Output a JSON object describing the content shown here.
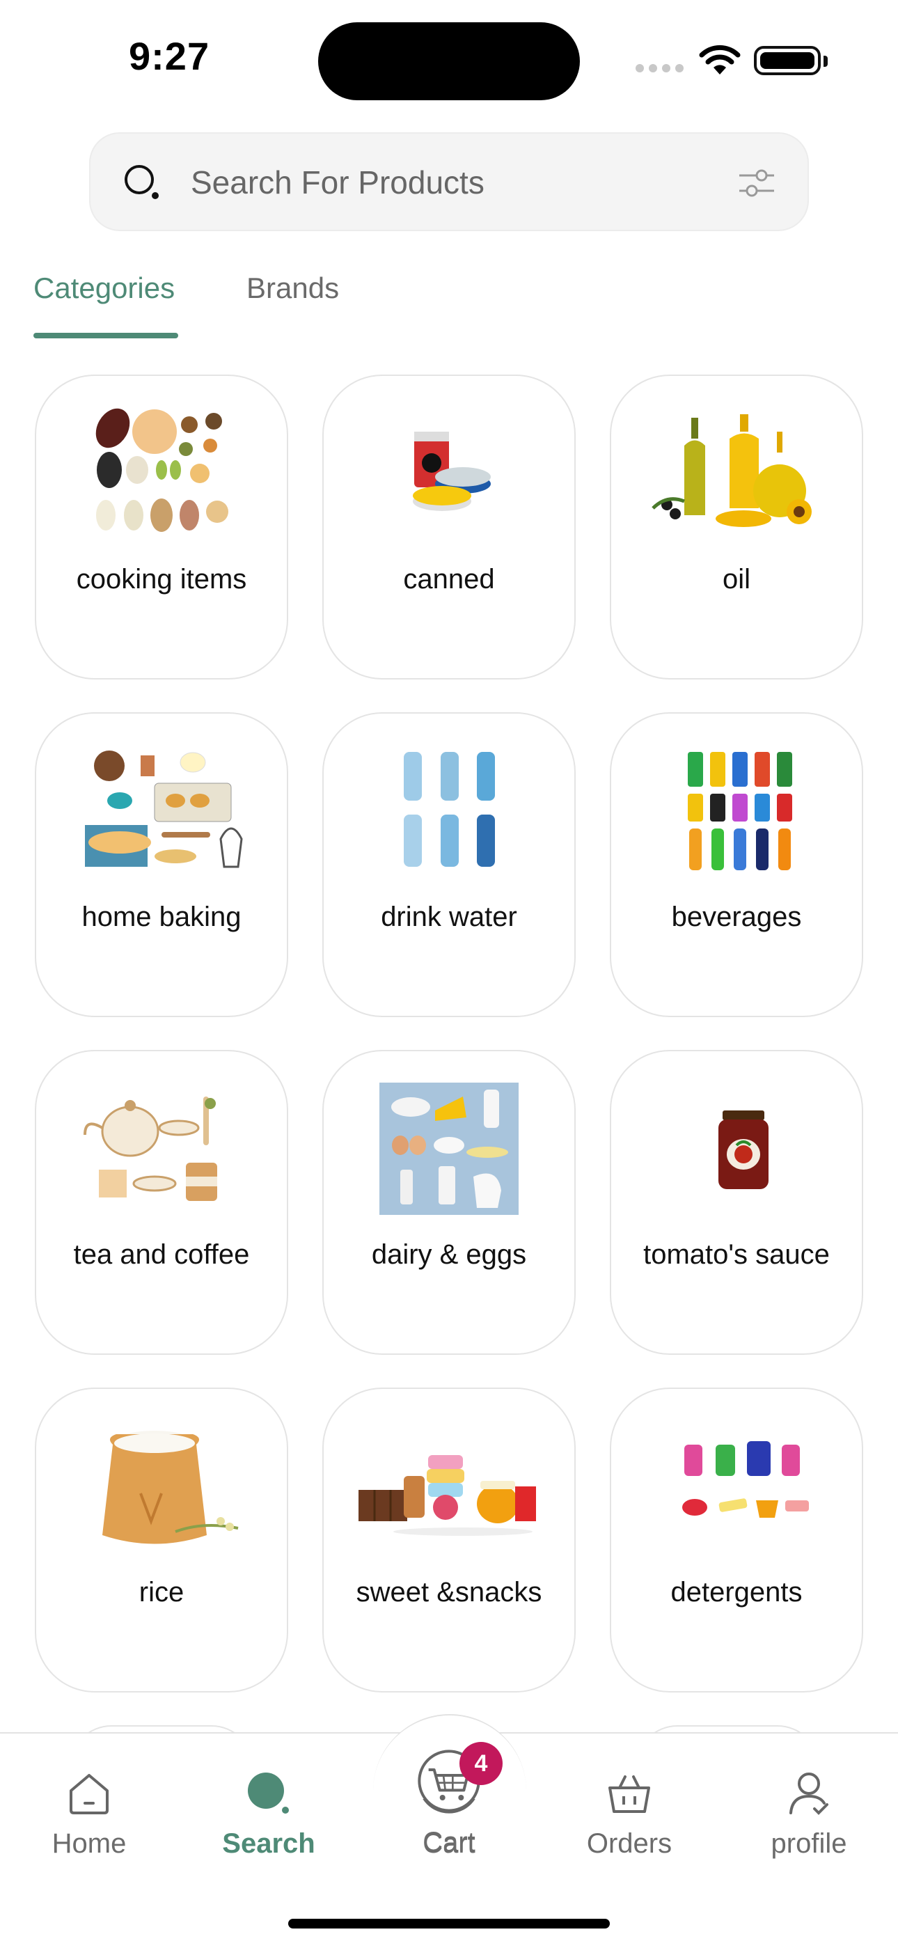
{
  "status_bar": {
    "time": "9:27"
  },
  "search": {
    "placeholder": "Search For Products"
  },
  "tabs": [
    {
      "label": "Categories",
      "active": true
    },
    {
      "label": "Brands",
      "active": false
    }
  ],
  "categories": [
    {
      "label": "cooking items",
      "icon": "legumes-icon"
    },
    {
      "label": "canned",
      "icon": "canned-food-icon"
    },
    {
      "label": "oil",
      "icon": "oil-bottles-icon"
    },
    {
      "label": "home baking",
      "icon": "baking-icon"
    },
    {
      "label": "drink water",
      "icon": "water-bottles-icon"
    },
    {
      "label": "beverages",
      "icon": "soda-cans-icon"
    },
    {
      "label": "tea and coffee",
      "icon": "teapot-icon"
    },
    {
      "label": "dairy & eggs",
      "icon": "dairy-icon"
    },
    {
      "label": "tomato's sauce",
      "icon": "sauce-jar-icon"
    },
    {
      "label": "rice",
      "icon": "rice-sack-icon"
    },
    {
      "label": "sweet &snacks",
      "icon": "sweets-icon"
    },
    {
      "label": "detergents",
      "icon": "detergent-icon"
    }
  ],
  "nav": {
    "items": [
      {
        "label": "Home",
        "icon": "home-icon"
      },
      {
        "label": "Search",
        "icon": "search-icon",
        "active": true
      },
      {
        "label": "Cart",
        "icon": "cart-icon"
      },
      {
        "label": "Orders",
        "icon": "basket-icon"
      },
      {
        "label": "profile",
        "icon": "user-icon"
      }
    ],
    "cart_count": "4"
  },
  "colors": {
    "accent": "#4e8a76",
    "badge": "#c2185b"
  }
}
